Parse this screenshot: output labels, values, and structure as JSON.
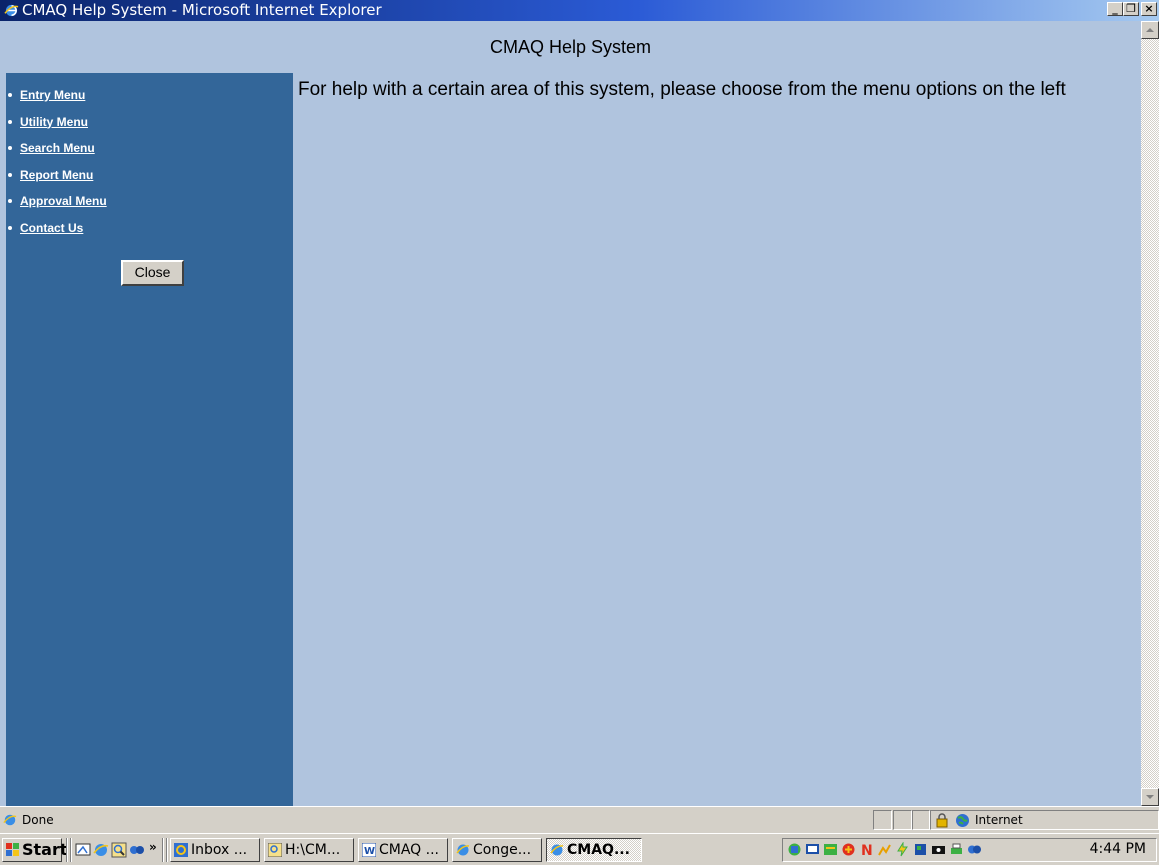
{
  "window": {
    "title": "CMAQ Help System - Microsoft Internet Explorer",
    "minimize_glyph": "_",
    "maximize_glyph": "❐",
    "close_glyph": "×"
  },
  "page": {
    "header": "CMAQ Help System",
    "intro": "For help with a certain area of this system, please choose from the menu options on the left"
  },
  "sidebar": {
    "items": [
      {
        "label": "Entry Menu"
      },
      {
        "label": "Utility Menu"
      },
      {
        "label": "Search Menu"
      },
      {
        "label": "Report Menu"
      },
      {
        "label": "Approval Menu"
      },
      {
        "label": "Contact Us"
      }
    ],
    "close_label": "Close"
  },
  "status": {
    "text": "Done",
    "zone": "Internet"
  },
  "taskbar": {
    "start_label": "Start",
    "quicklaunch_more": "»",
    "tasks": [
      {
        "label": "Inbox ...",
        "icon": "outlook-icon"
      },
      {
        "label": "H:\\CM...",
        "icon": "explorer-icon"
      },
      {
        "label": "CMAQ ...",
        "icon": "word-icon"
      },
      {
        "label": "Conge...",
        "icon": "ie-icon"
      },
      {
        "label": "CMAQ...",
        "icon": "ie-icon",
        "active": true
      }
    ],
    "clock": "4:44 PM"
  },
  "colors": {
    "page_bg": "#b0c4de",
    "sidebar_bg": "#336699",
    "title_gradient_start": "#0a246a",
    "title_gradient_end": "#a6caf0"
  }
}
